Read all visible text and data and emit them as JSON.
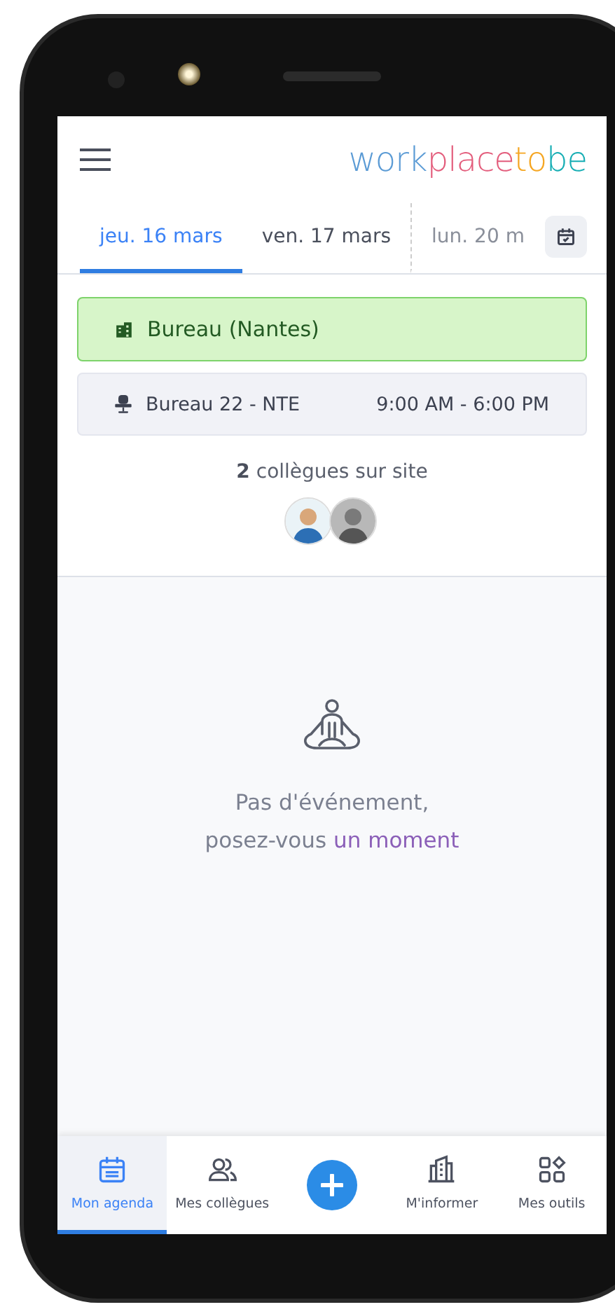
{
  "logo": [
    {
      "text": "work",
      "color": "#5b9bd5"
    },
    {
      "text": "place",
      "color": "#e35d7c"
    },
    {
      "text": "to",
      "color": "#f5a623"
    },
    {
      "text": "be",
      "color": "#17aeb4"
    }
  ],
  "day_tabs": [
    {
      "label": "jeu. 16 mars",
      "selected": true
    },
    {
      "label": "ven. 17 mars",
      "selected": false
    },
    {
      "label": "lun. 20 m",
      "selected": false
    }
  ],
  "location": {
    "label": "Bureau (Nantes)"
  },
  "desk": {
    "label": "Bureau 22 - NTE",
    "hours": "9:00 AM - 6:00 PM"
  },
  "colleagues": {
    "summary": "**2** collègues sur site",
    "avatars": [
      {
        "kind": "avatar"
      },
      {
        "kind": "avatar"
      }
    ]
  },
  "empty_state": {
    "line_1": "Pas d'événement,",
    "line_2": "posez-vous",
    "link": "un moment"
  },
  "bottom_nav": [
    {
      "kind": "agenda",
      "label": "Mon agenda",
      "selected": true
    },
    {
      "kind": "colleagues",
      "label": "Mes collègues",
      "selected": false
    },
    {
      "kind": "add",
      "selected": false
    },
    {
      "kind": "info",
      "label": "M'informer",
      "selected": false
    },
    {
      "kind": "tools",
      "label": "Mes outils",
      "selected": false
    }
  ]
}
